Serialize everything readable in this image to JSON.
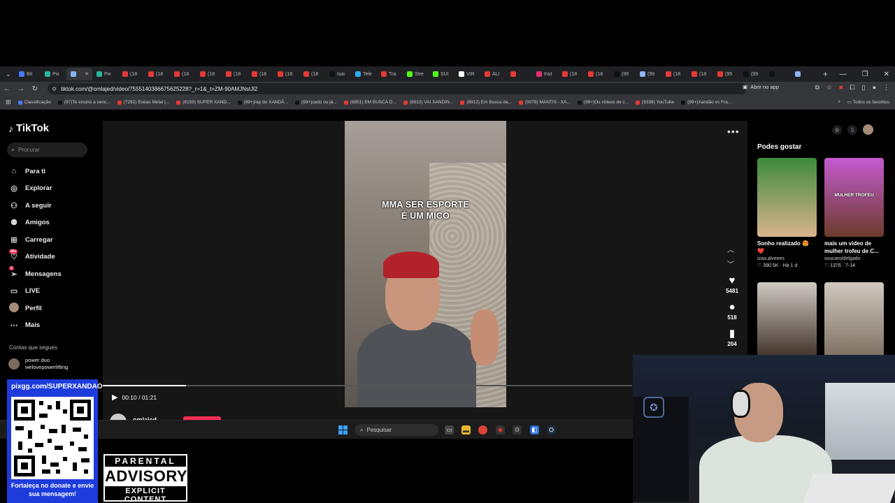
{
  "browser": {
    "tabs": [
      {
        "label": "Bit",
        "color": "#4a7bf7"
      },
      {
        "label": "Pix",
        "color": "#2bb5a0"
      },
      {
        "label": "",
        "color": "#8ab4f8",
        "active": true
      },
      {
        "label": "Pix",
        "color": "#2bb5a0"
      },
      {
        "label": "(18",
        "color": "#e53935"
      },
      {
        "label": "(18",
        "color": "#e53935"
      },
      {
        "label": "(18",
        "color": "#e53935"
      },
      {
        "label": "(18",
        "color": "#e53935"
      },
      {
        "label": "(18",
        "color": "#e53935"
      },
      {
        "label": "(18",
        "color": "#e53935"
      },
      {
        "label": "(18",
        "color": "#e53935"
      },
      {
        "label": "(18",
        "color": "#e53935"
      },
      {
        "label": "Isai",
        "color": "#111111"
      },
      {
        "label": "Tele",
        "color": "#2aabee"
      },
      {
        "label": "Tra",
        "color": "#e53935"
      },
      {
        "label": "Stre",
        "color": "#53fc18"
      },
      {
        "label": "SUI",
        "color": "#53fc18"
      },
      {
        "label": "VIR",
        "color": "#ffffff"
      },
      {
        "label": "ALI",
        "color": "#e53935"
      },
      {
        "label": "",
        "color": "#e53935"
      },
      {
        "label": "Inst",
        "color": "#e1306c"
      },
      {
        "label": "(18",
        "color": "#e53935"
      },
      {
        "label": "(18",
        "color": "#e53935"
      },
      {
        "label": "(99",
        "color": "#111111"
      },
      {
        "label": "(99",
        "color": "#8ab4f8"
      },
      {
        "label": "(18",
        "color": "#e53935"
      },
      {
        "label": "(18",
        "color": "#e53935"
      },
      {
        "label": "(95",
        "color": "#e53935"
      },
      {
        "label": "(99",
        "color": "#111111"
      },
      {
        "label": "",
        "color": "#111111"
      },
      {
        "label": "",
        "color": "#8ab4f8"
      }
    ],
    "new_tab": "+",
    "window_controls": {
      "minimize": "—",
      "maximize": "❐",
      "close": "✕"
    },
    "url": "tiktok.com/@omlajed/video/7555140386675625228?_r=1&_t=ZM-90AMJNstJl2",
    "open_app": "Abrir no app",
    "bookmarks": [
      {
        "label": "Classificação",
        "color": "#4a7bf7"
      },
      {
        "label": "(97)Te ensino a venc...",
        "color": "#111111"
      },
      {
        "label": "(7292) Enéas Metal |...",
        "color": "#e53935"
      },
      {
        "label": "(8159) SUPER XAND...",
        "color": "#e53935"
      },
      {
        "label": "(99+)rap do XANDÃ...",
        "color": "#111111"
      },
      {
        "label": "(99+)cedo ou já...",
        "color": "#111111"
      },
      {
        "label": "(8851) EM BUSCA D...",
        "color": "#e53935"
      },
      {
        "label": "(8912) VAI XANDIN...",
        "color": "#e53935"
      },
      {
        "label": "(8912) Em Busca da...",
        "color": "#e53935"
      },
      {
        "label": "(9078) MANTIS - XA...",
        "color": "#e53935"
      },
      {
        "label": "(99+)Os vídeos de c...",
        "color": "#111111"
      },
      {
        "label": "(9338) YouTube",
        "color": "#e53935"
      },
      {
        "label": "(99+)Xandão vs Fra...",
        "color": "#111111"
      }
    ],
    "bookmarks_more": "»",
    "all_bookmarks": "Todos os favoritos"
  },
  "tiktok": {
    "logo": "TikTok",
    "search_placeholder": "Procurar",
    "nav": [
      {
        "label": "Para ti",
        "icon": "home-icon",
        "glyph": "⌂"
      },
      {
        "label": "Explorar",
        "icon": "compass-icon",
        "glyph": "◎"
      },
      {
        "label": "A seguir",
        "icon": "following-icon",
        "glyph": "⚇"
      },
      {
        "label": "Amigos",
        "icon": "friends-icon",
        "glyph": "⚉"
      },
      {
        "label": "Carregar",
        "icon": "upload-icon",
        "glyph": "⊞"
      },
      {
        "label": "Atividade",
        "icon": "activity-icon",
        "glyph": "♡",
        "badge": "99+"
      },
      {
        "label": "Mensagens",
        "icon": "messages-icon",
        "glyph": "➢",
        "badge": "2"
      },
      {
        "label": "LIVE",
        "icon": "live-icon",
        "glyph": "▭"
      },
      {
        "label": "Perfil",
        "icon": "profile-avatar-icon",
        "glyph": ""
      },
      {
        "label": "Mais",
        "icon": "more-icon",
        "glyph": "⋯"
      }
    ],
    "following_title": "Contas que segues",
    "following": {
      "name": "power duo",
      "handle": "welovepowerlifting"
    },
    "video": {
      "caption_line1": "MMA SER ESPORTE",
      "caption_line2": "É UM MICO",
      "time": "00:10 / 01:21",
      "progress": 0.157,
      "author": "omlajed"
    },
    "actions": {
      "likes": "5481",
      "comments": "518",
      "saves": "204"
    },
    "recommend_title": "Podes gostar",
    "recommendations": [
      {
        "title": "Sonho realizado 😍 ❤️",
        "user": "izaa.alveees",
        "stats": "♡ 390.5K · Há 1 d",
        "overlay": "",
        "c1": "#3c8a3c",
        "c2": "#d9b38c"
      },
      {
        "title": "mais um video de mulher trofeu de C...",
        "user": "soucaroldelgado",
        "stats": "♡ 1376 · 7-14",
        "overlay": "MULHER TROFEU",
        "c1": "#c45bd1",
        "c2": "#6b3b2a"
      },
      {
        "title": "",
        "user": "",
        "stats": "",
        "overlay": "",
        "c1": "#cfcac3",
        "c2": "#3a2a22"
      },
      {
        "title": "",
        "user": "",
        "stats": "",
        "overlay": "",
        "c1": "#cfc9c0",
        "c2": "#7a6b5d"
      }
    ]
  },
  "taskbar": {
    "search_placeholder": "Pesquisar",
    "apps": [
      "file-explorer",
      "folder",
      "chrome",
      "app-red",
      "settings",
      "store",
      "steam"
    ]
  },
  "overlay": {
    "qr_url": "pixgg.com/SUPERXANDAO",
    "qr_message": "Fortaleça no donate e envie sua mensagem!",
    "advisory_line1": "PARENTAL",
    "advisory_line2": "ADVISORY",
    "advisory_line3": "EXPLICIT CONTENT"
  },
  "colors": {
    "accent": "#fe2c55",
    "qr_panel": "#1e3cdc",
    "chrome_bg": "#35363a",
    "tab_bg": "#202124"
  }
}
